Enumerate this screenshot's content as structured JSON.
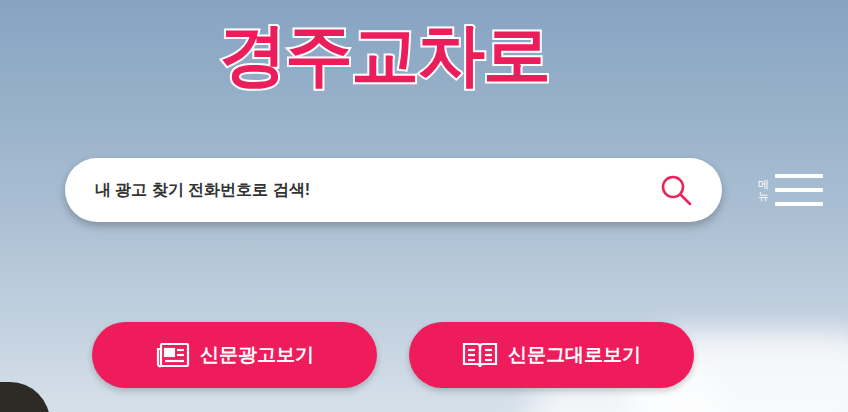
{
  "logo": {
    "text": "경주교차로"
  },
  "search": {
    "placeholder": "내 광고 찾기 전화번호로 검색!"
  },
  "menu": {
    "label": "메뉴"
  },
  "buttons": [
    {
      "label": "신문광고보기",
      "kind": "newspaper"
    },
    {
      "label": "신문그대로보기",
      "kind": "book"
    }
  ]
}
